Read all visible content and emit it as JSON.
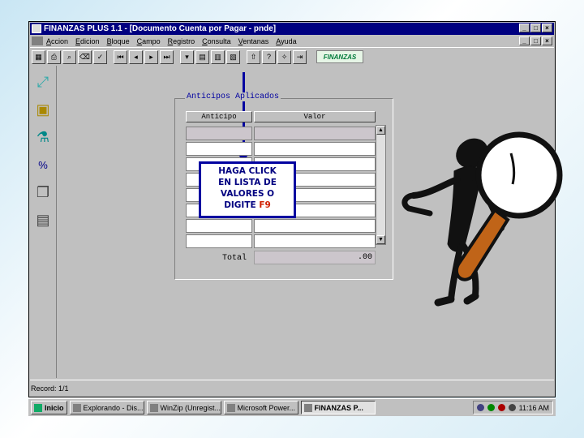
{
  "window": {
    "title": "FINANZAS PLUS 1.1 - [Documento Cuenta por Pagar - pnde]",
    "minimize": "_",
    "maximize": "□",
    "close": "×"
  },
  "menu": {
    "items": [
      "Accion",
      "Edicion",
      "Bloque",
      "Campo",
      "Registro",
      "Consulta",
      "Ventanas",
      "Ayuda"
    ]
  },
  "toolbar": {
    "brand": "FINANZAS",
    "icons": [
      "save-icon",
      "print-icon",
      "find-icon",
      "first-record-icon",
      "prev-record-icon",
      "next-record-icon",
      "last-record-icon",
      "list-values-icon",
      "exit-icon",
      "help-icon"
    ]
  },
  "panel": {
    "title": "Anticipos Aplicados",
    "columns": [
      "Anticipo",
      "Valor"
    ],
    "total_label": "Total",
    "total_value": ".00"
  },
  "callout": {
    "line1": "HAGA CLICK",
    "line2": "EN LISTA DE",
    "line3": "VALORES O",
    "line4": "DIGITE",
    "key": "F9"
  },
  "status": {
    "record": "Record: 1/1"
  },
  "taskbar": {
    "start": "Inicio",
    "buttons": [
      "Explorando - Dis...",
      "WinZip (Unregist...",
      "Microsoft Power...",
      "FINANZAS P..."
    ],
    "clock": "11:16 AM"
  }
}
